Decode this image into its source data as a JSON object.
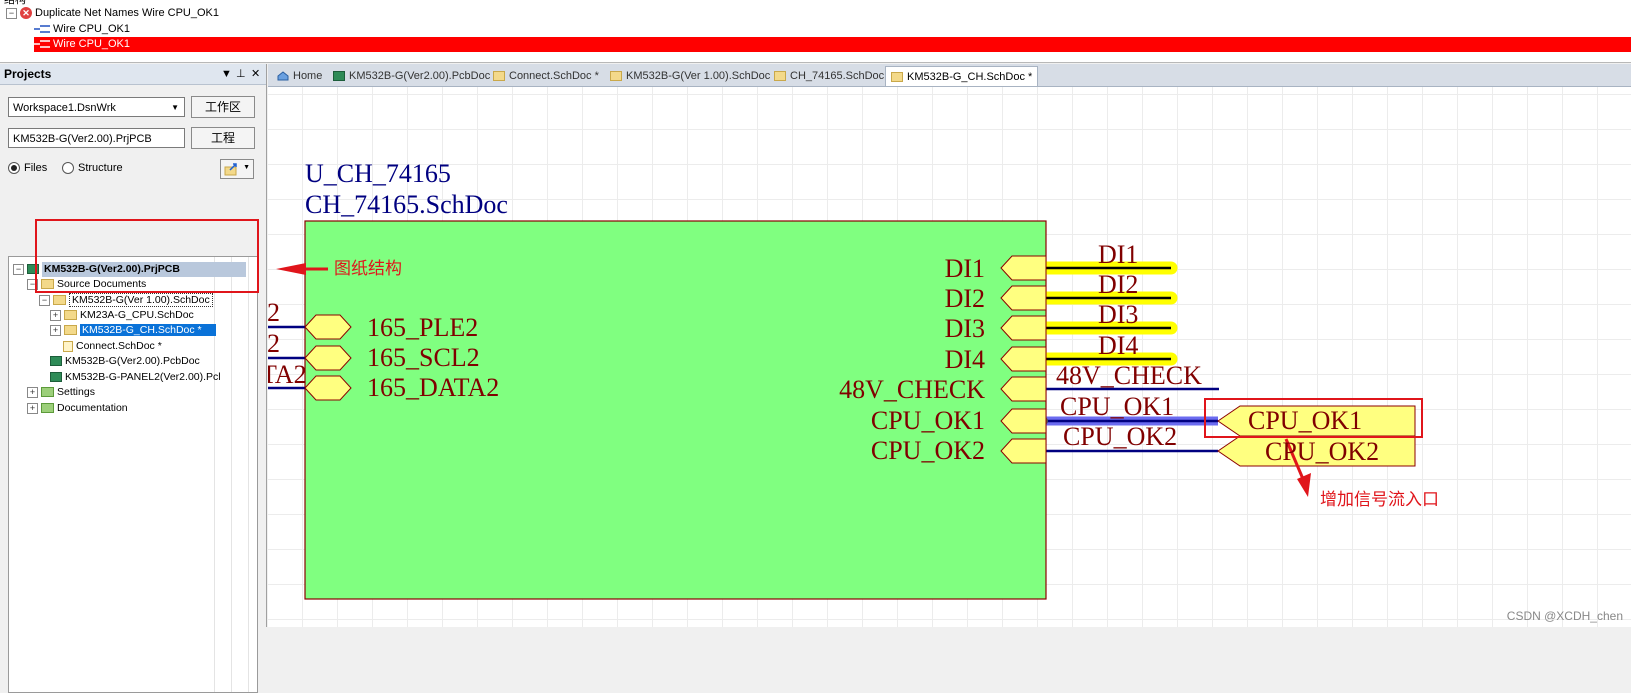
{
  "messages": {
    "header": "结构",
    "rows": [
      {
        "text": "Duplicate Net Names Wire CPU_OK1",
        "type": "error"
      },
      {
        "text": "Wire CPU_OK1",
        "type": "wire"
      },
      {
        "text": "Wire CPU_OK1",
        "type": "wire",
        "selected": true
      }
    ]
  },
  "projects_panel": {
    "title": "Projects",
    "controls": [
      "▼",
      "⊥",
      "✕"
    ],
    "workspace": "Workspace1.DsnWrk",
    "workspace_button": "工作区",
    "project": "KM532B-G(Ver2.00).PrjPCB",
    "project_button": "工程",
    "view_files": "Files",
    "view_structure": "Structure",
    "tree": [
      {
        "label": "KM532B-G(Ver2.00).PrjPCB",
        "level": 0,
        "icon": "project",
        "expander": "−",
        "style": "proj"
      },
      {
        "label": "Source Documents",
        "level": 1,
        "icon": "folder",
        "expander": "−"
      },
      {
        "label": "KM532B-G(Ver 1.00).SchDoc",
        "level": 2,
        "icon": "folder",
        "expander": "−",
        "style": "focus"
      },
      {
        "label": "KM23A-G_CPU.SchDoc",
        "level": 3,
        "icon": "folder",
        "expander": "+"
      },
      {
        "label": "KM532B-G_CH.SchDoc *",
        "level": 3,
        "icon": "folder",
        "expander": "+",
        "style": "sel"
      },
      {
        "label": "Connect.SchDoc *",
        "level": 3,
        "icon": "doc",
        "expander": ""
      },
      {
        "label": "KM532B-G(Ver2.00).PcbDoc",
        "level": 2,
        "icon": "pcb",
        "expander": ""
      },
      {
        "label": "KM532B-G-PANEL2(Ver2.00).Pcl",
        "level": 2,
        "icon": "pcb",
        "expander": ""
      },
      {
        "label": "Settings",
        "level": 1,
        "icon": "gfolder",
        "expander": "+"
      },
      {
        "label": "Documentation",
        "level": 1,
        "icon": "gfolder",
        "expander": "+"
      }
    ]
  },
  "tabs": [
    {
      "label": "Home",
      "icon": "home-icon"
    },
    {
      "label": "KM532B-G(Ver2.00).PcbDoc",
      "icon": "pcb-icon"
    },
    {
      "label": "Connect.SchDoc *",
      "icon": "sch-icon"
    },
    {
      "label": "KM532B-G(Ver 1.00).SchDoc",
      "icon": "sch-icon"
    },
    {
      "label": "CH_74165.SchDoc",
      "icon": "sch-icon"
    },
    {
      "label": "KM532B-G_CH.SchDoc *",
      "icon": "sch-icon",
      "active": true
    }
  ],
  "schematic": {
    "designator": "U_CH_74165",
    "filename": "CH_74165.SchDoc",
    "left_entries": [
      "165_PLE2",
      "165_SCL2",
      "165_DATA2"
    ],
    "left_partial_labels": [
      "2",
      "2",
      "TA2"
    ],
    "right_entries": [
      "DI1",
      "DI2",
      "DI3",
      "DI4",
      "48V_CHECK",
      "CPU_OK1",
      "CPU_OK2"
    ],
    "net_labels": [
      "DI1",
      "DI2",
      "DI3",
      "DI4",
      "48V_CHECK",
      "CPU_OK1",
      "CPU_OK2"
    ],
    "ports": [
      "CPU_OK1",
      "CPU_OK2"
    ],
    "colors": {
      "sheet_fill": "#80ff80",
      "border": "#8b0000",
      "wire": "#000080",
      "highlight": "#ffff00",
      "port_fill": "#ffff80",
      "text_blue": "#000080",
      "text_red": "#800000",
      "annotation": "#e0151b"
    }
  },
  "annotations": {
    "structure": "图纸结构",
    "entry": "增加信号流入口"
  },
  "watermark": "CSDN @XCDH_chen"
}
